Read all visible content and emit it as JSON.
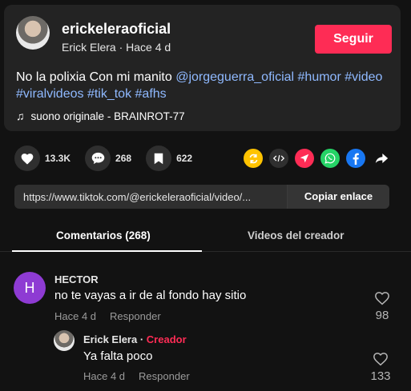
{
  "post": {
    "username": "erickeleraoficial",
    "display_name": "Erick Elera",
    "separator": " · ",
    "time_ago": "Hace 4 d",
    "follow_label": "Seguir",
    "caption_text": "No la polixia Con mi manito ",
    "caption_tags": [
      "@jorgeguerra_oficial",
      "#humor",
      "#video",
      "#viralvideos",
      "#tik_tok",
      "#afhs"
    ],
    "music": "suono originale - BRAINROT-77"
  },
  "stats": {
    "likes": "13.3K",
    "comments": "268",
    "saves": "622"
  },
  "share_icons": [
    "repost-icon",
    "embed-icon",
    "send-icon",
    "whatsapp-icon",
    "facebook-icon",
    "share-arrow-icon"
  ],
  "share_colors": {
    "repost": "#ffc300",
    "embed": "#2f2f2f",
    "send": "#fe2c55",
    "whatsapp": "#25d366",
    "facebook": "#1877f2"
  },
  "link": {
    "url": "https://www.tiktok.com/@erickeleraoficial/video/...",
    "copy_label": "Copiar enlace"
  },
  "tabs": {
    "comments": "Comentarios (268)",
    "creator_videos": "Videos del creador"
  },
  "comments": [
    {
      "avatar_initial": "H",
      "avatar_color": "#8e3bd3",
      "user": "HECTOR",
      "text": "no te vayas a ir de al fondo hay sitio",
      "time": "Hace 4 d",
      "reply_label": "Responder",
      "likes": "98",
      "replies": [
        {
          "user": "Erick Elera",
          "separator": " · ",
          "badge": "Creador",
          "text": "Ya falta poco",
          "time": "Hace 4 d",
          "reply_label": "Responder",
          "likes": "133"
        }
      ]
    }
  ]
}
